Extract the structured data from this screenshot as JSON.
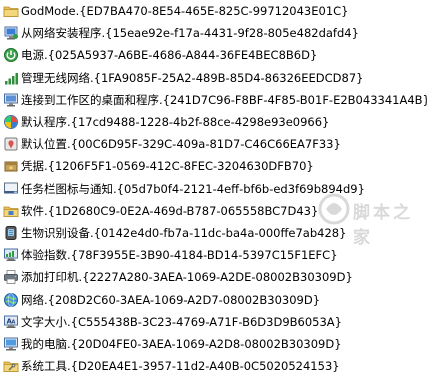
{
  "items": [
    {
      "label": "GodMode.{ED7BA470-8E54-465E-825C-99712043E01C}",
      "icon": "folder-icon"
    },
    {
      "label": "从网络安装程序.{15eae92e-f17a-4431-9f28-805e482dafd4}",
      "icon": "network-install-icon"
    },
    {
      "label": "电源.{025A5937-A6BE-4686-A844-36FE4BEC8B6D}",
      "icon": "power-icon"
    },
    {
      "label": "管理无线网络.{1FA9085F-25A2-489B-85D4-86326EEDCD87}",
      "icon": "wireless-icon"
    },
    {
      "label": "连接到工作区的桌面和程序.{241D7C96-F8BF-4F85-B01F-E2B043341A4B}",
      "icon": "remote-desktop-icon"
    },
    {
      "label": "默认程序.{17cd9488-1228-4b2f-88ce-4298e93e0966}",
      "icon": "default-programs-icon"
    },
    {
      "label": "默认位置.{00C6D95F-329C-409a-81D7-C46C66EA7F33}",
      "icon": "default-location-icon"
    },
    {
      "label": "凭据.{1206F5F1-0569-412C-8FEC-3204630DFB70}",
      "icon": "credentials-icon"
    },
    {
      "label": "任务栏图标与通知.{05d7b0f4-2121-4eff-bf6b-ed3f69b894d9}",
      "icon": "taskbar-notification-icon"
    },
    {
      "label": "软件.{1D2680C9-0E2A-469d-B787-065558BC7D43}",
      "icon": "software-icon"
    },
    {
      "label": "生物识别设备.{0142e4d0-fb7a-11dc-ba4a-000ffe7ab428}",
      "icon": "biometric-icon"
    },
    {
      "label": "体验指数.{78F3955E-3B90-4184-BD14-5397C15F1EFC}",
      "icon": "performance-index-icon"
    },
    {
      "label": "添加打印机.{2227A280-3AEA-1069-A2DE-08002B30309D}",
      "icon": "printer-icon"
    },
    {
      "label": "网络.{208D2C60-3AEA-1069-A2D7-08002B30309D}",
      "icon": "network-icon"
    },
    {
      "label": "文字大小.{C555438B-3C23-4769-A71F-B6D3D9B6053A}",
      "icon": "text-size-icon"
    },
    {
      "label": "我的电脑.{20D04FE0-3AEA-1069-A2D8-08002B30309D}",
      "icon": "my-computer-icon"
    },
    {
      "label": "系统工具.{D20EA4E1-3957-11d2-A40B-0C5020524153}",
      "icon": "system-tools-icon"
    }
  ],
  "watermark": {
    "text": "脚本之家",
    "icon": "watermark-logo-icon"
  },
  "colors": {
    "folder": "#e8c25a",
    "text": "#000000",
    "background": "#ffffff"
  }
}
